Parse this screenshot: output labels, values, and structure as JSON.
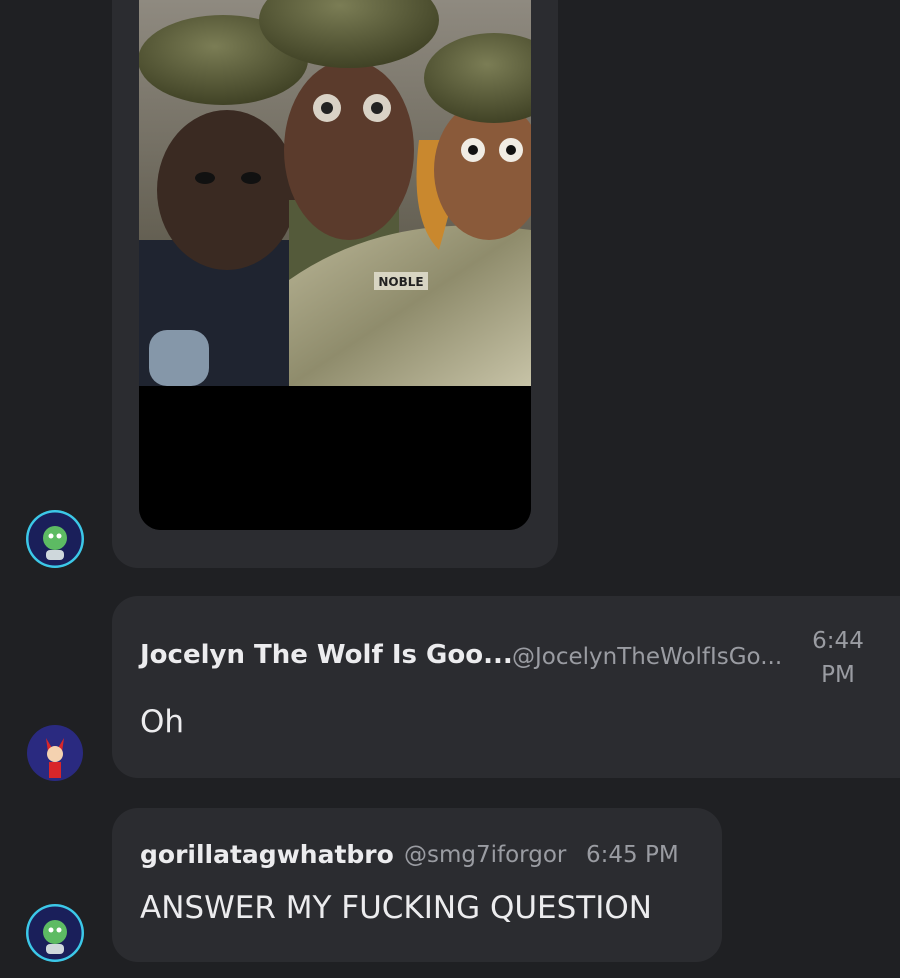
{
  "colors": {
    "background": "#1f2023",
    "bubble": "#2b2c30",
    "text": "#ececee",
    "muted": "#9a9ca2"
  },
  "media": {
    "icon": "image-attachment",
    "visible_label": "NOBLE"
  },
  "messages": [
    {
      "author": "Jocelyn The Wolf Is Goo...",
      "handle": "@JocelynTheWolfIsGo...",
      "time_line1": "6:44",
      "time_line2": "PM",
      "text": "Oh"
    },
    {
      "author": "gorillatagwhatbro",
      "handle": "@smg7iforgor",
      "time": "6:45 PM",
      "text": "ANSWER MY FUCKING QUESTION"
    }
  ]
}
